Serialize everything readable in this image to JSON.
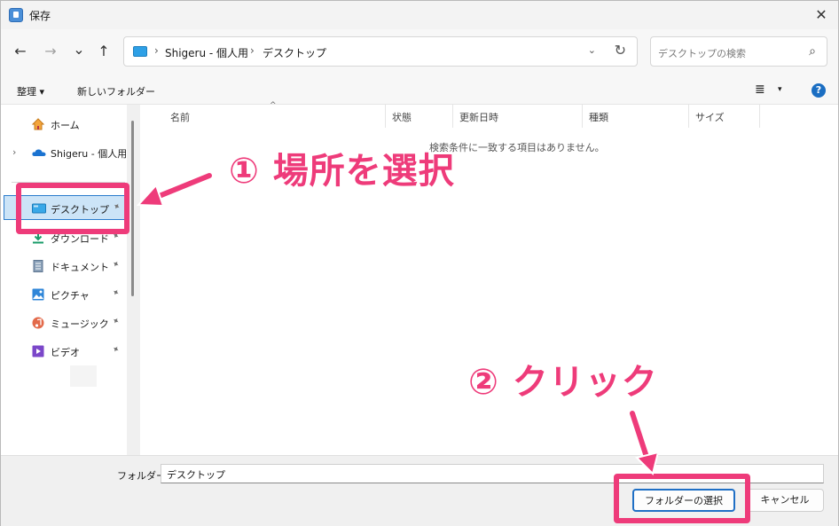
{
  "window": {
    "title": "保存",
    "close_glyph": "✕"
  },
  "nav": {
    "back_glyph": "←",
    "forward_glyph": "→",
    "recent_glyph": "⌄",
    "up_glyph": "↑",
    "breadcrumb": [
      {
        "label": "Shigeru - 個人用"
      },
      {
        "label": "デスクトップ"
      }
    ],
    "separator_glyph": "›",
    "dropdown_glyph": "⌄",
    "refresh_glyph": "↻",
    "search_placeholder": "デスクトップの検索",
    "search_glyph": "⌕"
  },
  "toolbar": {
    "organize_label": "整理 ▾",
    "new_folder_label": "新しいフォルダー",
    "view_glyph": "≣",
    "view_drop_glyph": "▾",
    "help_glyph": "?"
  },
  "sidebar": {
    "home_label": "ホーム",
    "onedrive_label": "Shigeru - 個人用",
    "expander_glyph": "›",
    "pin_glyph": "📌",
    "quick_access": [
      {
        "label": "デスクトップ",
        "icon": "desktop-icon"
      },
      {
        "label": "ダウンロード",
        "icon": "download-icon"
      },
      {
        "label": "ドキュメント",
        "icon": "document-icon"
      },
      {
        "label": "ピクチャ",
        "icon": "pictures-icon"
      },
      {
        "label": "ミュージック",
        "icon": "music-icon"
      },
      {
        "label": "ビデオ",
        "icon": "video-icon"
      }
    ]
  },
  "filelist": {
    "columns": [
      "名前",
      "状態",
      "更新日時",
      "種類",
      "サイズ"
    ],
    "sort_glyph": "^",
    "empty_message": "検索条件に一致する項目はありません。"
  },
  "bottom": {
    "folder_label": "フォルダー:",
    "folder_value": "デスクトップ",
    "select_button": "フォルダーの選択",
    "cancel_button": "キャンセル"
  },
  "annotations": {
    "step1": "① 場所を選択",
    "step2": "② クリック",
    "accent_color": "#ee3b7a"
  }
}
